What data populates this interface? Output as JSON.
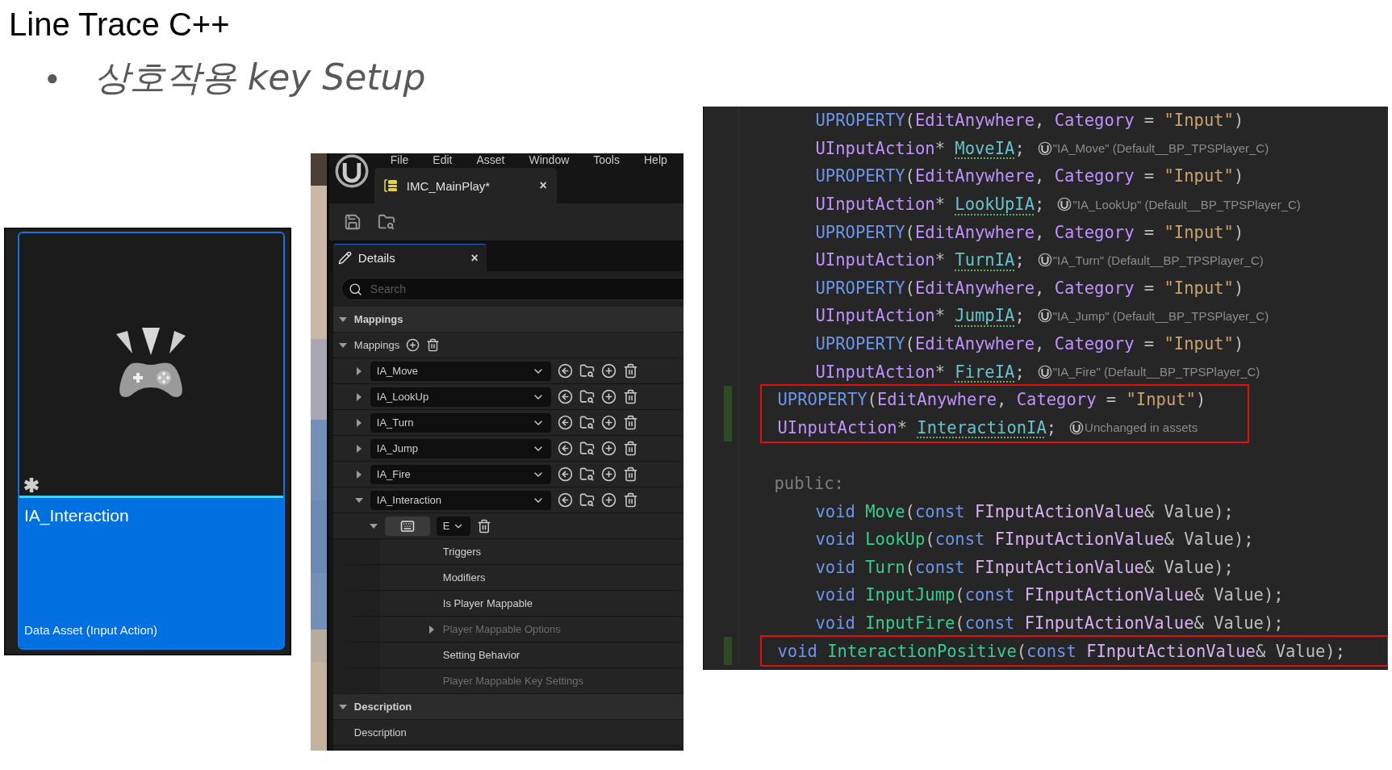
{
  "slide": {
    "title": "Line Trace C++",
    "bullet": "●",
    "subtitle": "상호작용 key Setup"
  },
  "asset_card": {
    "name": "IA_Interaction",
    "type": "Data Asset (Input Action)",
    "selected": true
  },
  "editor": {
    "menu": [
      "File",
      "Edit",
      "Asset",
      "Window",
      "Tools",
      "Help"
    ],
    "tab": {
      "title": "IMC_MainPlay*",
      "close": "×"
    },
    "details_tab": {
      "title": "Details",
      "close": "×"
    },
    "search": {
      "placeholder": "Search"
    },
    "mappings_header": {
      "title": "Mappings",
      "expanded": true
    },
    "mappings_array": {
      "label": "Mappings",
      "expanded": true
    },
    "mappings": [
      {
        "action": "IA_Move",
        "expanded": false
      },
      {
        "action": "IA_LookUp",
        "expanded": false
      },
      {
        "action": "IA_Turn",
        "expanded": false
      },
      {
        "action": "IA_Jump",
        "expanded": false
      },
      {
        "action": "IA_Fire",
        "expanded": false
      },
      {
        "action": "IA_Interaction",
        "expanded": true,
        "key": {
          "value": "E",
          "expanded": true
        },
        "properties": [
          {
            "label": "Triggers",
            "disabled": false,
            "expandable": false
          },
          {
            "label": "Modifiers",
            "disabled": false,
            "expandable": false
          },
          {
            "label": "Is Player Mappable",
            "disabled": false,
            "expandable": false
          },
          {
            "label": "Player Mappable Options",
            "disabled": true,
            "expandable": true
          },
          {
            "label": "Setting Behavior",
            "disabled": false,
            "expandable": false
          },
          {
            "label": "Player Mappable Key Settings",
            "disabled": true,
            "expandable": false
          }
        ]
      }
    ],
    "description_header": {
      "title": "Description",
      "expanded": true
    },
    "description_row": {
      "label": "Description"
    }
  },
  "code": {
    "blocks": [
      {
        "highlighted": false,
        "changed": false,
        "lines": [
          {
            "kind": "member",
            "tokens": [
              {
                "text": "UPROPERTY",
                "kind": "macro"
              },
              {
                "text": "(",
                "kind": "punct"
              },
              {
                "text": "EditAnywhere",
                "kind": "attr"
              },
              {
                "text": ", ",
                "kind": "punct"
              },
              {
                "text": "Category",
                "kind": "attr"
              },
              {
                "text": " = ",
                "kind": "punct"
              },
              {
                "text": "\"Input\"",
                "kind": "string"
              },
              {
                "text": ")",
                "kind": "punct"
              }
            ]
          },
          {
            "kind": "member",
            "tokens": [
              {
                "text": "UInputAction",
                "kind": "type"
              },
              {
                "text": "* ",
                "kind": "punct"
              },
              {
                "text": "MoveIA",
                "kind": "field"
              },
              {
                "text": ";",
                "kind": "punct"
              }
            ],
            "hint": "\"IA_Move\" (Default__BP_TPSPlayer_C)"
          },
          {
            "kind": "member",
            "tokens": [
              {
                "text": "UPROPERTY",
                "kind": "macro"
              },
              {
                "text": "(",
                "kind": "punct"
              },
              {
                "text": "EditAnywhere",
                "kind": "attr"
              },
              {
                "text": ", ",
                "kind": "punct"
              },
              {
                "text": "Category",
                "kind": "attr"
              },
              {
                "text": " = ",
                "kind": "punct"
              },
              {
                "text": "\"Input\"",
                "kind": "string"
              },
              {
                "text": ")",
                "kind": "punct"
              }
            ]
          },
          {
            "kind": "member",
            "tokens": [
              {
                "text": "UInputAction",
                "kind": "type"
              },
              {
                "text": "* ",
                "kind": "punct"
              },
              {
                "text": "LookUpIA",
                "kind": "field"
              },
              {
                "text": ";",
                "kind": "punct"
              }
            ],
            "hint": "\"IA_LookUp\" (Default__BP_TPSPlayer_C)"
          },
          {
            "kind": "member",
            "tokens": [
              {
                "text": "UPROPERTY",
                "kind": "macro"
              },
              {
                "text": "(",
                "kind": "punct"
              },
              {
                "text": "EditAnywhere",
                "kind": "attr"
              },
              {
                "text": ", ",
                "kind": "punct"
              },
              {
                "text": "Category",
                "kind": "attr"
              },
              {
                "text": " = ",
                "kind": "punct"
              },
              {
                "text": "\"Input\"",
                "kind": "string"
              },
              {
                "text": ")",
                "kind": "punct"
              }
            ]
          },
          {
            "kind": "member",
            "tokens": [
              {
                "text": "UInputAction",
                "kind": "type"
              },
              {
                "text": "* ",
                "kind": "punct"
              },
              {
                "text": "TurnIA",
                "kind": "field"
              },
              {
                "text": ";",
                "kind": "punct"
              }
            ],
            "hint": "\"IA_Turn\" (Default__BP_TPSPlayer_C)"
          },
          {
            "kind": "member",
            "tokens": [
              {
                "text": "UPROPERTY",
                "kind": "macro"
              },
              {
                "text": "(",
                "kind": "punct"
              },
              {
                "text": "EditAnywhere",
                "kind": "attr"
              },
              {
                "text": ", ",
                "kind": "punct"
              },
              {
                "text": "Category",
                "kind": "attr"
              },
              {
                "text": " = ",
                "kind": "punct"
              },
              {
                "text": "\"Input\"",
                "kind": "string"
              },
              {
                "text": ")",
                "kind": "punct"
              }
            ]
          },
          {
            "kind": "member",
            "tokens": [
              {
                "text": "UInputAction",
                "kind": "type"
              },
              {
                "text": "* ",
                "kind": "punct"
              },
              {
                "text": "JumpIA",
                "kind": "field"
              },
              {
                "text": ";",
                "kind": "punct"
              }
            ],
            "hint": "\"IA_Jump\" (Default__BP_TPSPlayer_C)"
          },
          {
            "kind": "member",
            "tokens": [
              {
                "text": "UPROPERTY",
                "kind": "macro"
              },
              {
                "text": "(",
                "kind": "punct"
              },
              {
                "text": "EditAnywhere",
                "kind": "attr"
              },
              {
                "text": ", ",
                "kind": "punct"
              },
              {
                "text": "Category",
                "kind": "attr"
              },
              {
                "text": " = ",
                "kind": "punct"
              },
              {
                "text": "\"Input\"",
                "kind": "string"
              },
              {
                "text": ")",
                "kind": "punct"
              }
            ]
          },
          {
            "kind": "member",
            "tokens": [
              {
                "text": "UInputAction",
                "kind": "type"
              },
              {
                "text": "* ",
                "kind": "punct"
              },
              {
                "text": "FireIA",
                "kind": "field"
              },
              {
                "text": ";",
                "kind": "punct"
              }
            ],
            "hint": "\"IA_Fire\" (Default__BP_TPSPlayer_C)"
          }
        ]
      },
      {
        "highlighted": true,
        "changed": true,
        "lines": [
          {
            "kind": "member",
            "tokens": [
              {
                "text": "UPROPERTY",
                "kind": "macro"
              },
              {
                "text": "(",
                "kind": "punct"
              },
              {
                "text": "EditAnywhere",
                "kind": "attr"
              },
              {
                "text": ", ",
                "kind": "punct"
              },
              {
                "text": "Category",
                "kind": "attr"
              },
              {
                "text": " = ",
                "kind": "punct"
              },
              {
                "text": "\"Input\"",
                "kind": "string"
              },
              {
                "text": ")",
                "kind": "punct"
              }
            ]
          },
          {
            "kind": "member",
            "tokens": [
              {
                "text": "UInputAction",
                "kind": "type"
              },
              {
                "text": "* ",
                "kind": "punct"
              },
              {
                "text": "InteractionIA",
                "kind": "field"
              },
              {
                "text": ";",
                "kind": "punct"
              }
            ],
            "hint": "Unchanged in assets"
          }
        ]
      },
      {
        "highlighted": false,
        "changed": false,
        "lines": [
          {
            "kind": "blank"
          },
          {
            "kind": "label",
            "tokens": [
              {
                "text": "public:",
                "kind": "label"
              }
            ]
          },
          {
            "kind": "member",
            "tokens": [
              {
                "text": "void ",
                "kind": "keyword"
              },
              {
                "text": "Move",
                "kind": "func"
              },
              {
                "text": "(",
                "kind": "punct"
              },
              {
                "text": "const ",
                "kind": "keyword"
              },
              {
                "text": "FInputActionValue",
                "kind": "ptype"
              },
              {
                "text": "& Value);",
                "kind": "punct"
              }
            ]
          },
          {
            "kind": "member",
            "tokens": [
              {
                "text": "void ",
                "kind": "keyword"
              },
              {
                "text": "LookUp",
                "kind": "func"
              },
              {
                "text": "(",
                "kind": "punct"
              },
              {
                "text": "const ",
                "kind": "keyword"
              },
              {
                "text": "FInputActionValue",
                "kind": "ptype"
              },
              {
                "text": "& Value);",
                "kind": "punct"
              }
            ]
          },
          {
            "kind": "member",
            "tokens": [
              {
                "text": "void ",
                "kind": "keyword"
              },
              {
                "text": "Turn",
                "kind": "func"
              },
              {
                "text": "(",
                "kind": "punct"
              },
              {
                "text": "const ",
                "kind": "keyword"
              },
              {
                "text": "FInputActionValue",
                "kind": "ptype"
              },
              {
                "text": "& Value);",
                "kind": "punct"
              }
            ]
          },
          {
            "kind": "member",
            "tokens": [
              {
                "text": "void ",
                "kind": "keyword"
              },
              {
                "text": "InputJump",
                "kind": "func"
              },
              {
                "text": "(",
                "kind": "punct"
              },
              {
                "text": "const ",
                "kind": "keyword"
              },
              {
                "text": "FInputActionValue",
                "kind": "ptype"
              },
              {
                "text": "& Value);",
                "kind": "punct"
              }
            ]
          },
          {
            "kind": "member",
            "tokens": [
              {
                "text": "void ",
                "kind": "keyword"
              },
              {
                "text": "InputFire",
                "kind": "func"
              },
              {
                "text": "(",
                "kind": "punct"
              },
              {
                "text": "const ",
                "kind": "keyword"
              },
              {
                "text": "FInputActionValue",
                "kind": "ptype"
              },
              {
                "text": "& Value);",
                "kind": "punct"
              }
            ]
          }
        ]
      },
      {
        "highlighted": true,
        "changed": true,
        "lines": [
          {
            "kind": "member",
            "tokens": [
              {
                "text": "void ",
                "kind": "keyword"
              },
              {
                "text": "InteractionPositive",
                "kind": "func"
              },
              {
                "text": "(",
                "kind": "punct"
              },
              {
                "text": "const ",
                "kind": "keyword"
              },
              {
                "text": "FInputActionValue",
                "kind": "ptype"
              },
              {
                "text": "& Value);",
                "kind": "punct"
              }
            ]
          }
        ]
      }
    ]
  }
}
